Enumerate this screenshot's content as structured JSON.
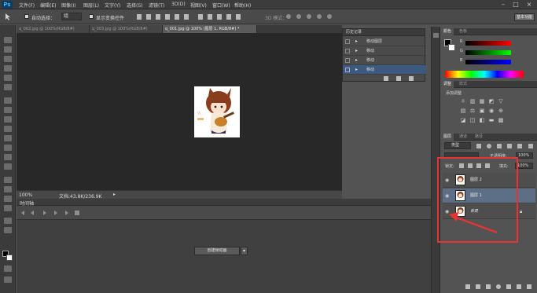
{
  "app": {
    "logo": "Ps"
  },
  "menu": [
    "文件(F)",
    "编辑(E)",
    "图像(I)",
    "图层(L)",
    "文字(Y)",
    "选择(S)",
    "滤镜(T)",
    "3D(D)",
    "视图(V)",
    "窗口(W)",
    "帮助(H)"
  ],
  "window_controls": [
    "–",
    "□",
    "×"
  ],
  "options": {
    "auto_select_label": "自动选择：",
    "auto_select_value": "组",
    "show_transform_label": "显示变换控件",
    "mode_3d_label": "3D 模式：",
    "workspace": "基本功能"
  },
  "tabs": [
    "q_002.jpg @ 100%(RGB/8#)",
    "q_003.jpg @ 100%(RGB/8#)",
    "q_001.jpg @ 100% (图层 1, RGB/8#) *"
  ],
  "status": {
    "zoom": "100%",
    "doc_info": "文档:43.8K/236.9K"
  },
  "timeline": {
    "title": "时间轴",
    "create_button": "创建帧动画"
  },
  "history": {
    "title": "历史记录",
    "items": [
      "移动图层",
      "移动",
      "移动",
      "移动"
    ]
  },
  "color_panel": {
    "tabs": [
      "颜色",
      "色板"
    ],
    "channels": [
      "R",
      "G",
      "B"
    ]
  },
  "adjust_panel": {
    "tabs": [
      "调整",
      "样式"
    ],
    "add_label": "添加调整"
  },
  "layers_panel": {
    "tabs": [
      "图层",
      "通道",
      "路径"
    ],
    "kind_label": "类型",
    "opacity_label": "不透明度:",
    "opacity_value": "100%",
    "lock_label": "锁定:",
    "fill_label": "填充:",
    "fill_value": "100%",
    "layers": [
      {
        "name": "图层 2",
        "selected": false
      },
      {
        "name": "图层 1",
        "selected": true
      },
      {
        "name": "背景",
        "selected": false
      }
    ]
  },
  "colors": {
    "highlight_box": "#e63333",
    "selection": "#3c5a80"
  }
}
